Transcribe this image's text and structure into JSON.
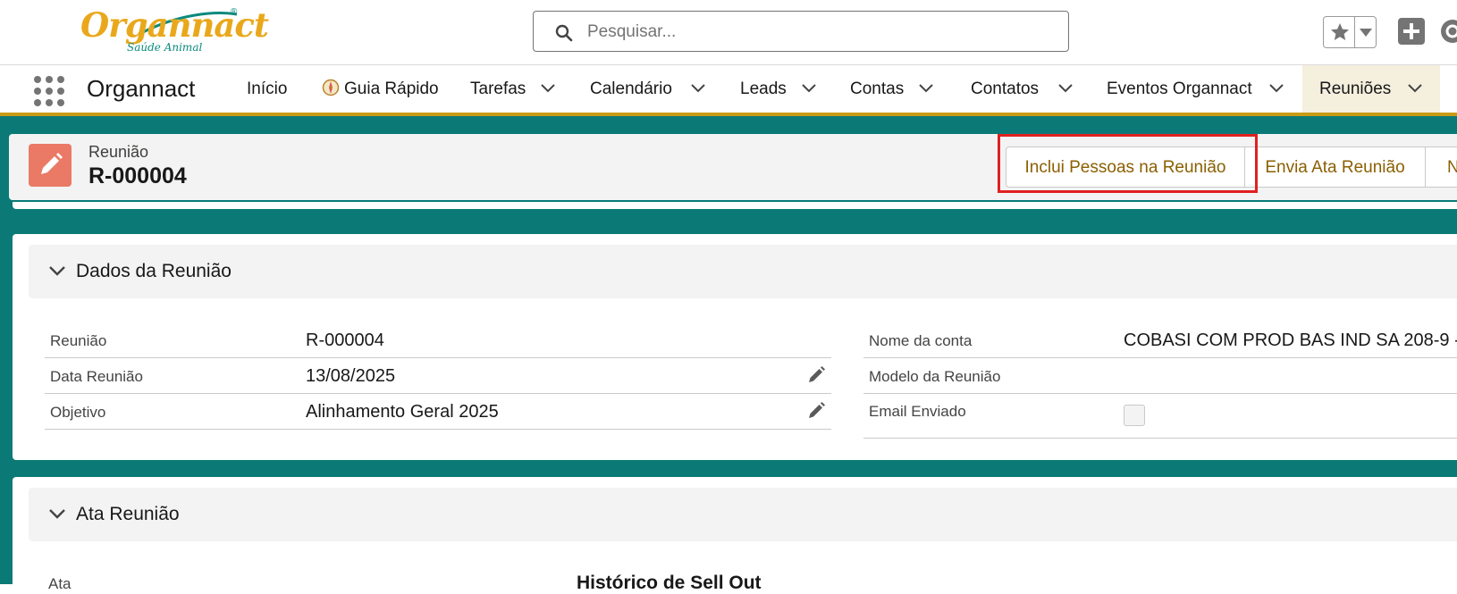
{
  "header": {
    "logo_text": "Organnact",
    "logo_tagline": "Saúde Animal",
    "search_placeholder": "Pesquisar..."
  },
  "nav": {
    "app_name": "Organnact",
    "tabs": [
      {
        "label": "Início"
      },
      {
        "label": "Guia Rápido"
      },
      {
        "label": "Tarefas"
      },
      {
        "label": "Calendário"
      },
      {
        "label": "Leads"
      },
      {
        "label": "Contas"
      },
      {
        "label": "Contatos"
      },
      {
        "label": "Eventos Organnact"
      },
      {
        "label": "Reuniões"
      }
    ]
  },
  "record": {
    "type_label": "Reunião",
    "name": "R-000004",
    "actions": [
      {
        "label": "Inclui Pessoas na Reunião"
      },
      {
        "label": "Envia Ata Reunião"
      },
      {
        "label": "N"
      }
    ]
  },
  "sections": {
    "dados": {
      "title": "Dados da Reunião",
      "left_fields": [
        {
          "label": "Reunião",
          "value": "R-000004"
        },
        {
          "label": "Data Reunião",
          "value": "13/08/2025"
        },
        {
          "label": "Objetivo",
          "value": "Alinhamento Geral 2025"
        }
      ],
      "right_fields": [
        {
          "label": "Nome da conta",
          "value": "COBASI COM PROD BAS IND SA 208-9 -"
        },
        {
          "label": "Modelo da Reunião",
          "value": ""
        },
        {
          "label": "Email Enviado",
          "value": ""
        }
      ]
    },
    "ata": {
      "title": "Ata Reunião",
      "field_label": "Ata",
      "content_heading": "Histórico de Sell Out"
    }
  },
  "colors": {
    "brand_gold": "#c99a14",
    "brand_teal": "#0b7a77",
    "record_icon": "#ea7a66",
    "highlight_red": "#e02020"
  },
  "icons": [
    "search-icon",
    "star-icon",
    "chevron-down-icon",
    "plus-icon",
    "help-icon",
    "app-launcher-icon",
    "compass-icon",
    "pencil-icon"
  ]
}
